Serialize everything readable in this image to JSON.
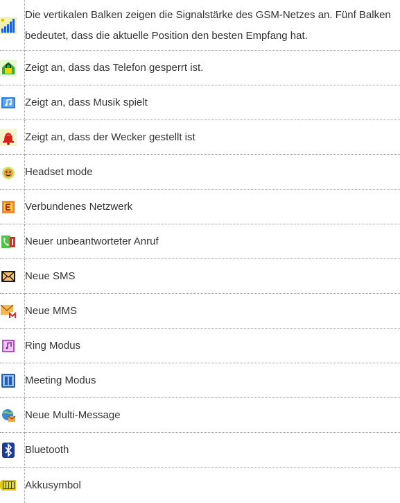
{
  "rows": [
    {
      "icon": "signal-strength-icon",
      "text": "Die vertikalen Balken zeigen die Signalstärke des GSM-Netzes an. Fünf Balken bedeutet, dass die aktuelle Position den besten Empfang hat."
    },
    {
      "icon": "lock-icon",
      "text": "Zeigt an, dass das Telefon gesperrt ist."
    },
    {
      "icon": "music-icon",
      "text": "Zeigt an, dass Musik spielt"
    },
    {
      "icon": "alarm-bell-icon",
      "text": "Zeigt an, dass der Wecker gestellt ist"
    },
    {
      "icon": "headset-icon",
      "text": "Headset mode"
    },
    {
      "icon": "network-e-icon",
      "text": "Verbundenes Netzwerk"
    },
    {
      "icon": "missed-call-icon",
      "text": "Neuer unbeantworteter Anruf"
    },
    {
      "icon": "sms-envelope-icon",
      "text": "Neue SMS"
    },
    {
      "icon": "mms-envelope-icon",
      "text": "Neue MMS"
    },
    {
      "icon": "ring-mode-icon",
      "text": "Ring Modus"
    },
    {
      "icon": "meeting-mode-icon",
      "text": "Meeting Modus"
    },
    {
      "icon": "multi-message-icon",
      "text": "Neue Multi-Message"
    },
    {
      "icon": "bluetooth-icon",
      "text": "Bluetooth"
    },
    {
      "icon": "battery-icon",
      "text": "Akkusymbol"
    }
  ]
}
